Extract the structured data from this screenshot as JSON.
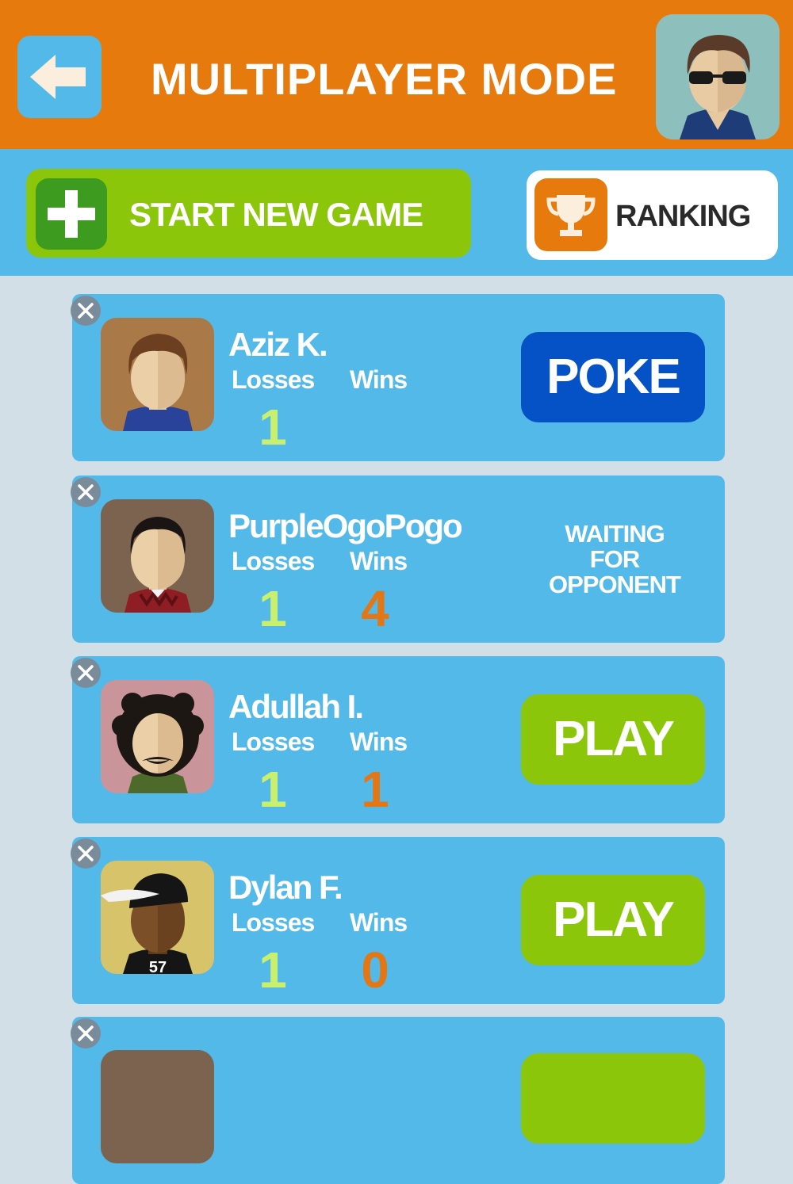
{
  "header": {
    "title": "MULTIPLAYER MODE",
    "back_icon": "arrow-left-icon",
    "profile_avatar": "avatar-sunglasses"
  },
  "toolbar": {
    "start_new_game": "START NEW GAME",
    "ranking": "RANKING",
    "start_icon": "plus-icon",
    "ranking_icon": "trophy-icon"
  },
  "colors": {
    "header": "#e67a0d",
    "toolbar": "#52b9e8",
    "card": "#52b9e8",
    "play": "#8cc60b",
    "poke": "#0452c6",
    "losses_number": "#c9ef6f",
    "wins_number": "#e37716",
    "page_background": "#d3dfe6"
  },
  "games": [
    {
      "name": "Aziz K.",
      "losses_label": "Losses",
      "wins_label": "Wins",
      "losses": "1",
      "wins": "",
      "action": "POKE",
      "avatar": "brown-hair-man"
    },
    {
      "name": "PurpleOgoPogo",
      "losses_label": "Losses",
      "wins_label": "Wins",
      "losses": "1",
      "wins": "4",
      "status_line1": "WAITING",
      "status_line2": "FOR",
      "status_line3": "OPPONENT",
      "avatar": "argyle-vest-man"
    },
    {
      "name": "Adullah I.",
      "losses_label": "Losses",
      "wins_label": "Wins",
      "losses": "1",
      "wins": "1",
      "action": "PLAY",
      "avatar": "curly-hair-man"
    },
    {
      "name": "Dylan F.",
      "losses_label": "Losses",
      "wins_label": "Wins",
      "losses": "1",
      "wins": "0",
      "action": "PLAY",
      "avatar": "cap-jersey-man",
      "jersey_number": "57"
    }
  ]
}
